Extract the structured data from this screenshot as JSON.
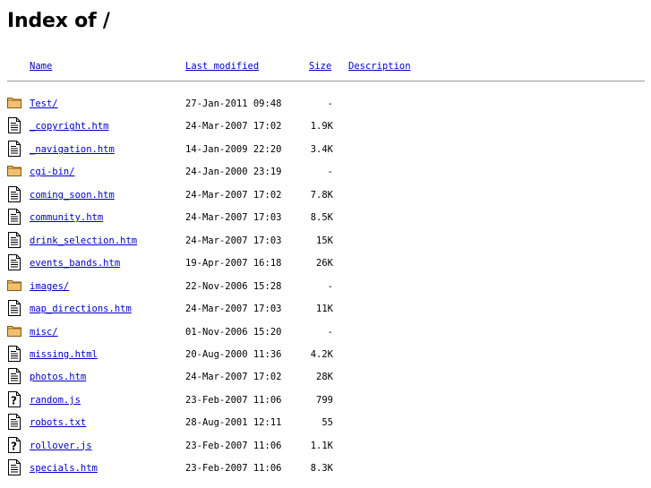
{
  "page": {
    "title": "Index of /"
  },
  "columns": {
    "name": "Name",
    "last_modified": "Last modified",
    "size": "Size",
    "description": "Description"
  },
  "entries": [
    {
      "icon": "folder-icon",
      "name": "Test/",
      "modified": "27-Jan-2011 09:48",
      "size": "-",
      "description": ""
    },
    {
      "icon": "document-icon",
      "name": "_copyright.htm",
      "modified": "24-Mar-2007 17:02",
      "size": "1.9K",
      "description": ""
    },
    {
      "icon": "document-icon",
      "name": "_navigation.htm",
      "modified": "14-Jan-2009 22:20",
      "size": "3.4K",
      "description": ""
    },
    {
      "icon": "folder-icon",
      "name": "cgi-bin/",
      "modified": "24-Jan-2000 23:19",
      "size": "-",
      "description": ""
    },
    {
      "icon": "document-icon",
      "name": "coming_soon.htm",
      "modified": "24-Mar-2007 17:02",
      "size": "7.8K",
      "description": ""
    },
    {
      "icon": "document-icon",
      "name": "community.htm",
      "modified": "24-Mar-2007 17:03",
      "size": "8.5K",
      "description": ""
    },
    {
      "icon": "document-icon",
      "name": "drink_selection.htm",
      "modified": "24-Mar-2007 17:03",
      "size": "15K",
      "description": ""
    },
    {
      "icon": "document-icon",
      "name": "events_bands.htm",
      "modified": "19-Apr-2007 16:18",
      "size": "26K",
      "description": ""
    },
    {
      "icon": "folder-icon",
      "name": "images/",
      "modified": "22-Nov-2006 15:28",
      "size": "-",
      "description": ""
    },
    {
      "icon": "document-icon",
      "name": "map_directions.htm",
      "modified": "24-Mar-2007 17:03",
      "size": "11K",
      "description": ""
    },
    {
      "icon": "folder-icon",
      "name": "misc/",
      "modified": "01-Nov-2006 15:20",
      "size": "-",
      "description": ""
    },
    {
      "icon": "document-icon",
      "name": "missing.html",
      "modified": "20-Aug-2000 11:36",
      "size": "4.2K",
      "description": ""
    },
    {
      "icon": "document-icon",
      "name": "photos.htm",
      "modified": "24-Mar-2007 17:02",
      "size": "28K",
      "description": ""
    },
    {
      "icon": "unknown-file-icon",
      "name": "random.js",
      "modified": "23-Feb-2007 11:06",
      "size": "799",
      "description": ""
    },
    {
      "icon": "document-icon",
      "name": "robots.txt",
      "modified": "28-Aug-2001 12:11",
      "size": "55",
      "description": ""
    },
    {
      "icon": "unknown-file-icon",
      "name": "rollover.js",
      "modified": "23-Feb-2007 11:06",
      "size": "1.1K",
      "description": ""
    },
    {
      "icon": "document-icon",
      "name": "specials.htm",
      "modified": "23-Feb-2007 11:06",
      "size": "8.3K",
      "description": ""
    }
  ],
  "colors": {
    "link": "#0000cc",
    "folder_fill": "#f0c070",
    "folder_stroke": "#8a5a10",
    "rule": "#9a9a9a"
  }
}
